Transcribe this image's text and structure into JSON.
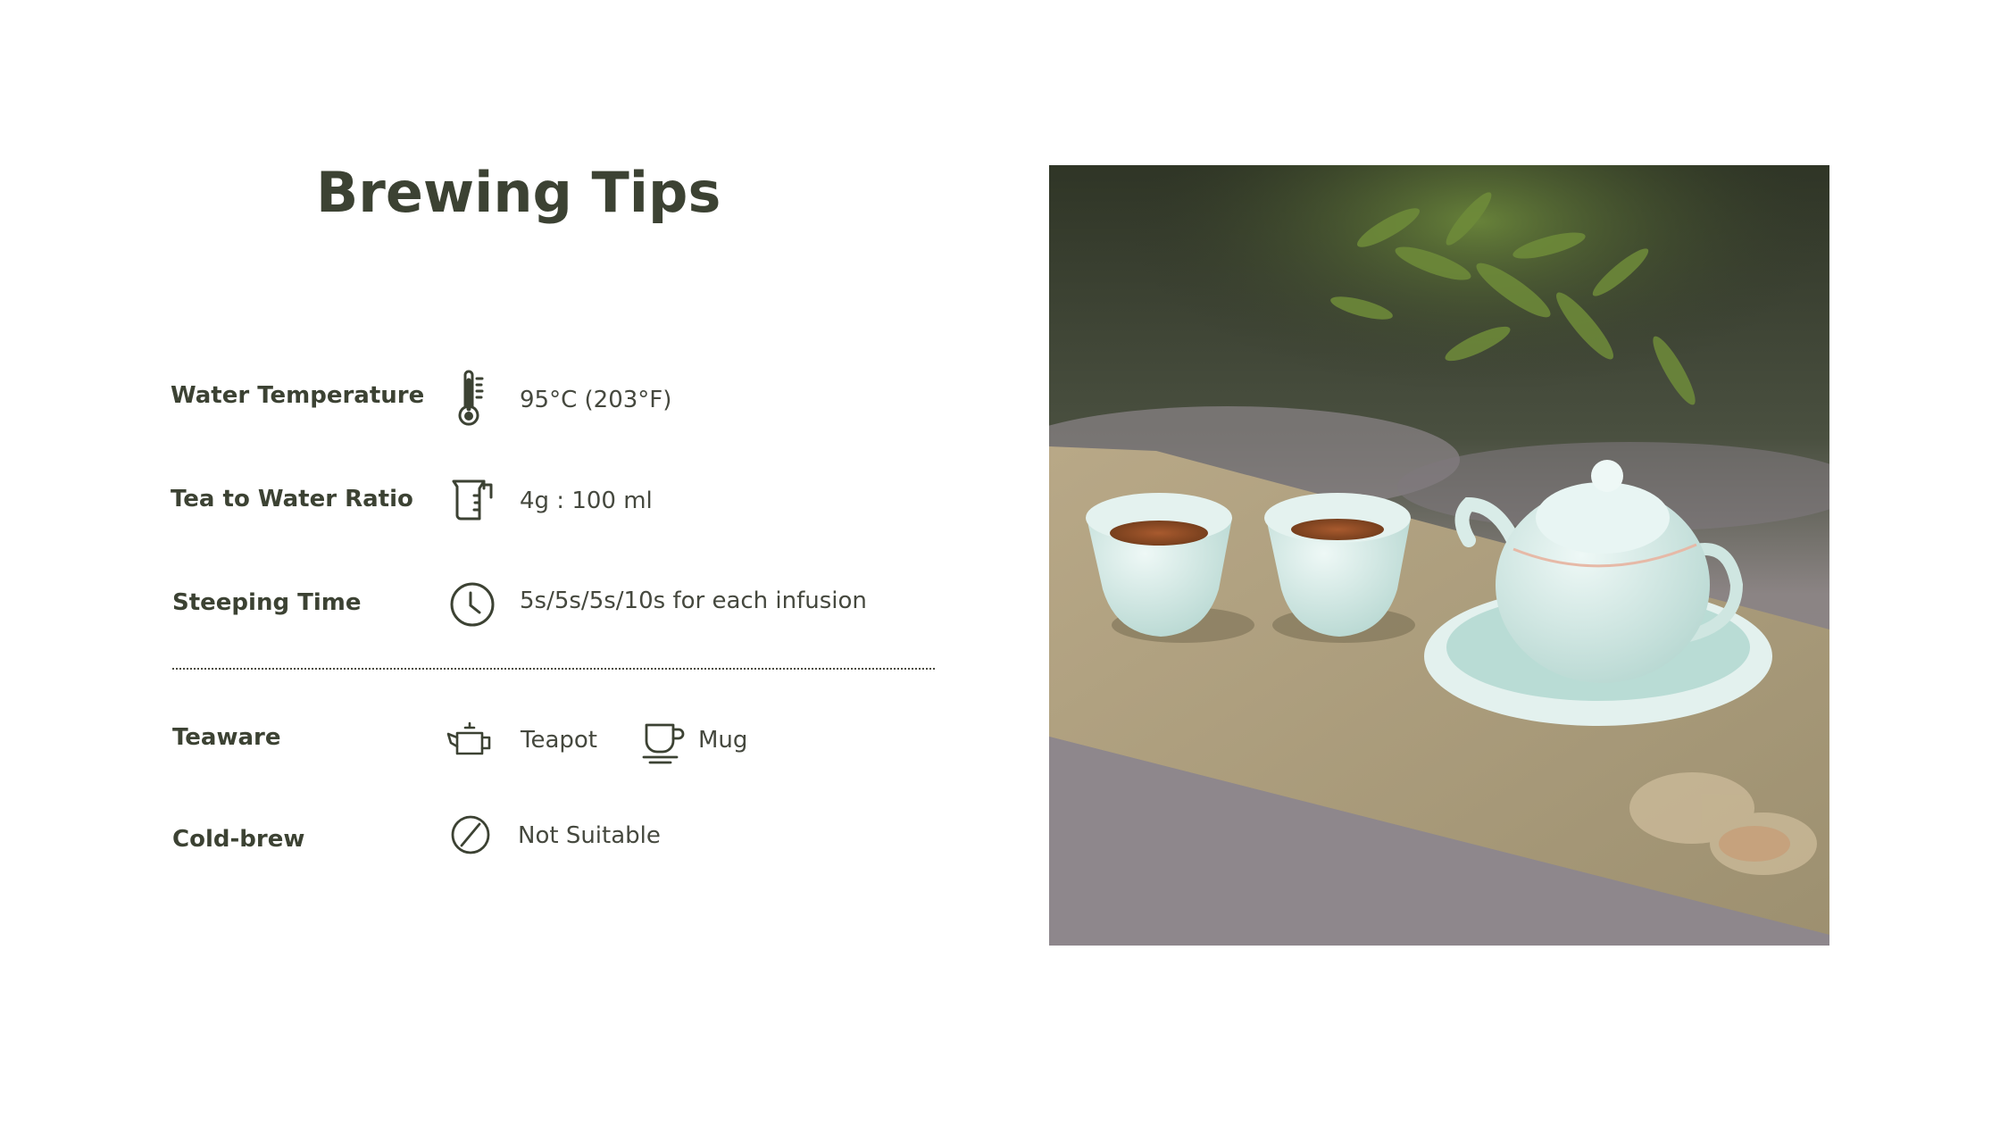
{
  "title": "Brewing Tips",
  "colors": {
    "text": "#3c4233",
    "background": "#ffffff",
    "accent": "#3c4233"
  },
  "tips": [
    {
      "label": "Water Temperature",
      "icon": "thermometer-icon",
      "value": "95°C (203°F)"
    },
    {
      "label": "Tea to Water Ratio",
      "icon": "measuring-jug-icon",
      "value": "4g : 100 ml"
    },
    {
      "label": "Steeping Time",
      "icon": "clock-icon",
      "value": "5s/5s/5s/10s for each infusion"
    }
  ],
  "teaware": {
    "label": "Teaware",
    "items": [
      {
        "icon": "teapot-icon",
        "name": "Teapot"
      },
      {
        "icon": "mug-icon",
        "name": "Mug"
      }
    ]
  },
  "coldbrew": {
    "label": "Cold-brew",
    "icon": "prohibited-icon",
    "value": "Not Suitable"
  },
  "photo": {
    "subject": "celadon-teapot-and-cups-photo"
  }
}
